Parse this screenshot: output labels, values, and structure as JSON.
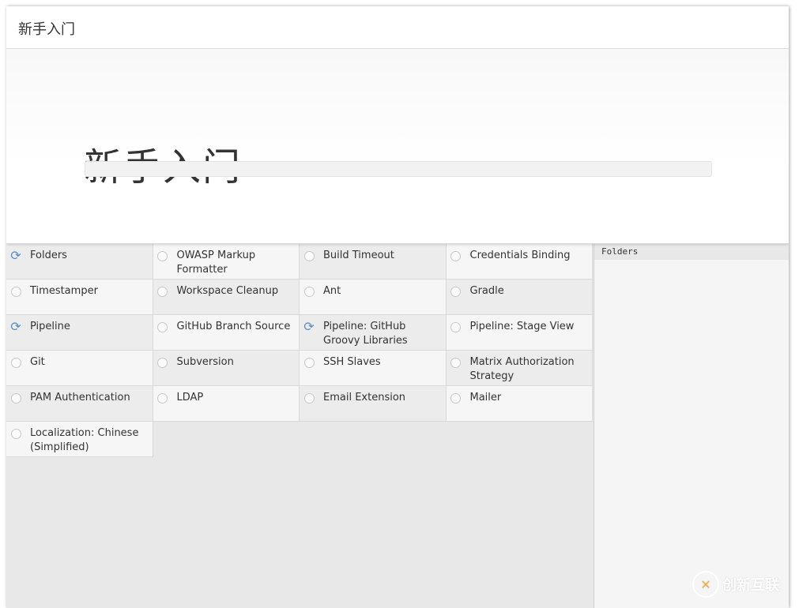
{
  "header": {
    "title": "新手入门"
  },
  "hero": {
    "title": "新手入门",
    "progress": 0.0
  },
  "plugins": [
    {
      "name": "Folders",
      "status": "installing"
    },
    {
      "name": "OWASP Markup Formatter",
      "status": "pending"
    },
    {
      "name": "Build Timeout",
      "status": "pending"
    },
    {
      "name": "Credentials Binding",
      "status": "pending"
    },
    {
      "name": "Timestamper",
      "status": "pending"
    },
    {
      "name": "Workspace Cleanup",
      "status": "pending"
    },
    {
      "name": "Ant",
      "status": "pending"
    },
    {
      "name": "Gradle",
      "status": "pending"
    },
    {
      "name": "Pipeline",
      "status": "installing"
    },
    {
      "name": "GitHub Branch Source",
      "status": "pending"
    },
    {
      "name": "Pipeline: GitHub Groovy Libraries",
      "status": "installing"
    },
    {
      "name": "Pipeline: Stage View",
      "status": "pending"
    },
    {
      "name": "Git",
      "status": "pending"
    },
    {
      "name": "Subversion",
      "status": "pending"
    },
    {
      "name": "SSH Slaves",
      "status": "pending"
    },
    {
      "name": "Matrix Authorization Strategy",
      "status": "pending"
    },
    {
      "name": "PAM Authentication",
      "status": "pending"
    },
    {
      "name": "LDAP",
      "status": "pending"
    },
    {
      "name": "Email Extension",
      "status": "pending"
    },
    {
      "name": "Mailer",
      "status": "pending"
    },
    {
      "name": "Localization: Chinese (Simplified)",
      "status": "pending"
    }
  ],
  "details": {
    "log_line": "Folders"
  },
  "watermark": {
    "text": "创新互联"
  },
  "icons": {
    "installing": "refresh-icon",
    "pending": "circle-icon"
  },
  "colors": {
    "accent": "#5a8fc8"
  }
}
